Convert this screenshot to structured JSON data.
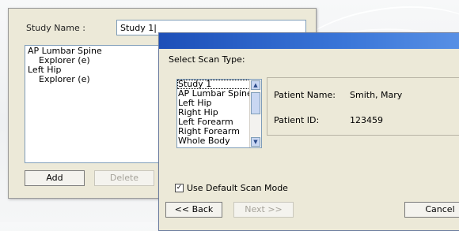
{
  "study_window": {
    "study_name_label": "Study Name :",
    "study_name_value": "Study 1",
    "study_list": [
      {
        "label": "AP Lumbar Spine",
        "children": [
          "Explorer (e)"
        ]
      },
      {
        "label": "Left Hip",
        "children": [
          "Explorer (e)"
        ]
      }
    ],
    "add_label": "Add",
    "delete_label": "Delete"
  },
  "scan_dialog": {
    "prompt": "Select Scan Type:",
    "scan_types": [
      "Study 1",
      "AP Lumbar Spine",
      "Left Hip",
      "Right Hip",
      "Left Forearm",
      "Right Forearm",
      "Whole Body"
    ],
    "selected_scan_type": "Study 1",
    "patient_name_label": "Patient Name:",
    "patient_name_value": "Smith, Mary",
    "patient_id_label": "Patient ID:",
    "patient_id_value": "123459",
    "default_mode_label": "Use Default Scan Mode",
    "default_mode_checked": true,
    "back_label": "<< Back",
    "next_label": "Next >>",
    "cancel_label": "Cancel"
  },
  "colors": {
    "title_bar": "#2a5fc4",
    "dialog_background": "#ece9d8"
  }
}
